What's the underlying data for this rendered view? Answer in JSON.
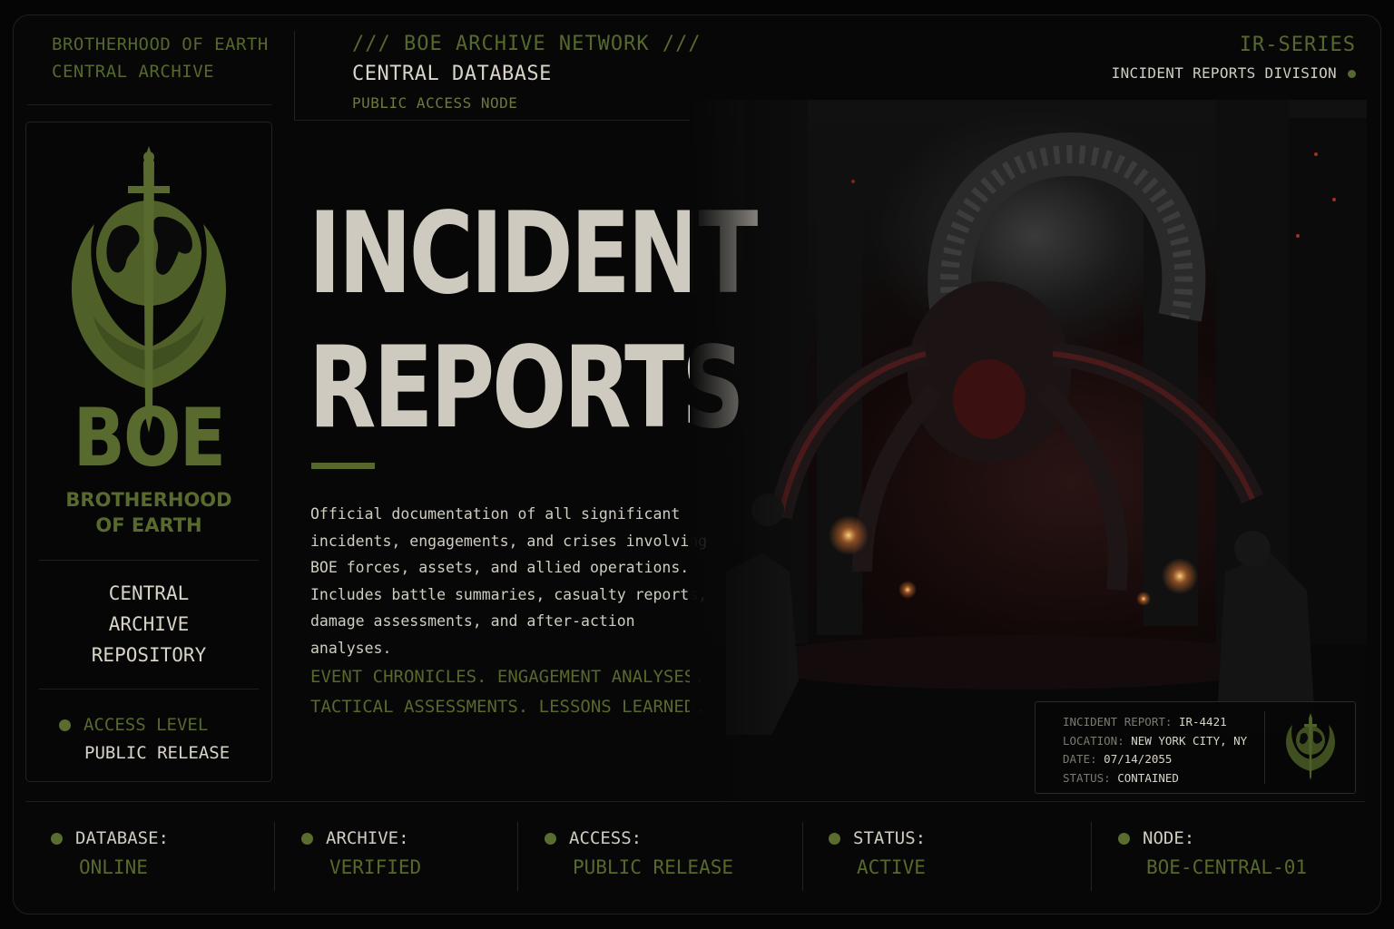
{
  "header": {
    "org_line1": "BROTHERHOOD OF EARTH",
    "org_line2": "CENTRAL ARCHIVE",
    "network_title": "/// BOE ARCHIVE NETWORK ///",
    "database": "CENTRAL DATABASE",
    "node": "PUBLIC ACCESS NODE",
    "series": "IR-SERIES",
    "division": "INCIDENT REPORTS DIVISION"
  },
  "sidebar": {
    "logo_text": "BOE",
    "org_name_line1": "BROTHERHOOD",
    "org_name_line2": "OF EARTH",
    "repo_line1": "CENTRAL",
    "repo_line2": "ARCHIVE",
    "repo_line3": "REPOSITORY",
    "access_label": "ACCESS LEVEL",
    "access_value": "PUBLIC RELEASE"
  },
  "hero": {
    "title_line1": "INCIDENT",
    "title_line2": "REPORTS",
    "description": "Official documentation of all significant\nincidents, engagements, and crises involving\nBOE forces, assets, and allied operations.\nIncludes battle summaries, casualty reports,\ndamage assessments, and after-action analyses.",
    "tagline": "EVENT CHRONICLES. ENGAGEMENT ANALYSES.\nTACTICAL ASSESSMENTS. LESSONS LEARNED."
  },
  "incident_card": {
    "report_key": "INCIDENT REPORT:",
    "report_val": "IR-4421",
    "location_key": "LOCATION:",
    "location_val": "NEW YORK CITY, NY",
    "date_key": "DATE:",
    "date_val": "07/14/2055",
    "status_key": "STATUS:",
    "status_val": "CONTAINED"
  },
  "status_bar": [
    {
      "label": "DATABASE:",
      "value": "ONLINE"
    },
    {
      "label": "ARCHIVE:",
      "value": "VERIFIED"
    },
    {
      "label": "ACCESS:",
      "value": "PUBLIC RELEASE"
    },
    {
      "label": "STATUS:",
      "value": "ACTIVE"
    },
    {
      "label": "NODE:",
      "value": "BOE-CENTRAL-01"
    }
  ],
  "colors": {
    "accent_green": "#57682d",
    "text_light": "#d8d4c8",
    "background": "#070707"
  },
  "icons": {
    "emblem": "sword-globe-wings-emblem",
    "status_dot": "status-dot-icon"
  }
}
